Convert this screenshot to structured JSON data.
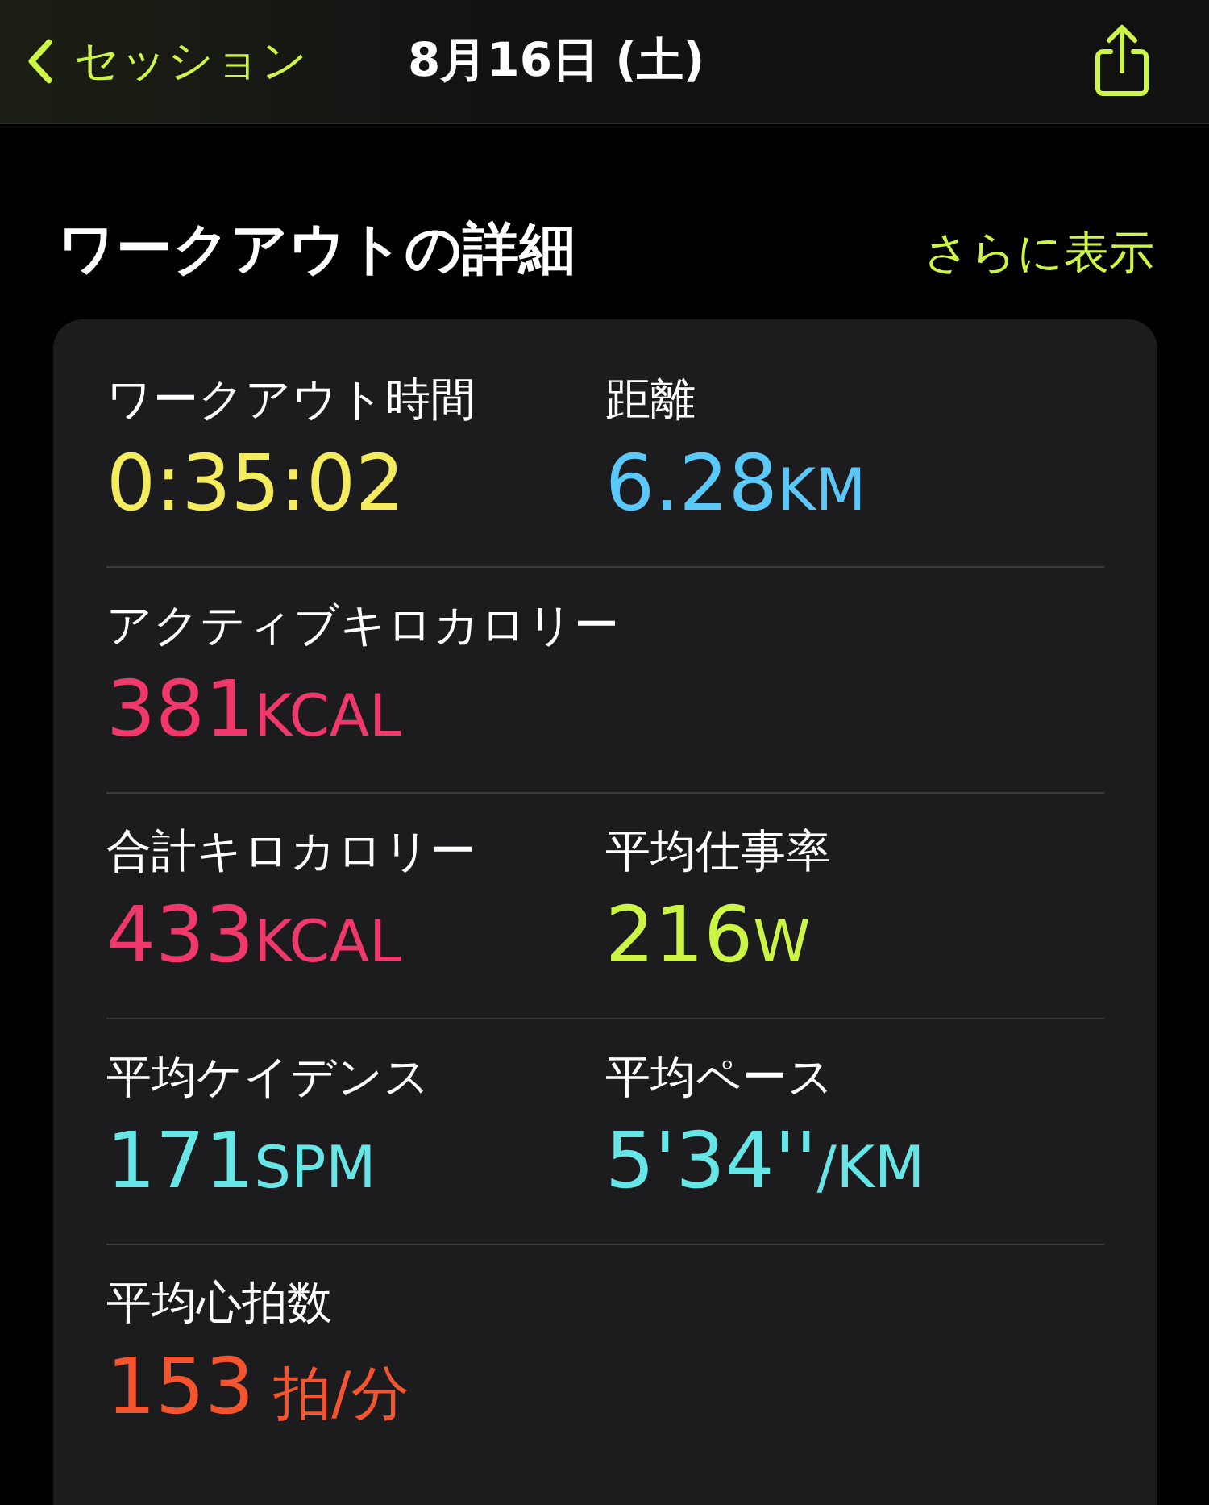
{
  "nav": {
    "back_label": "セッション",
    "title": "8月16日 (土)"
  },
  "section": {
    "title": "ワークアウトの詳細",
    "more_link": "さらに表示"
  },
  "rows": [
    {
      "metrics": [
        {
          "label": "ワークアウト時間",
          "value": "0:35:02",
          "color": "#f4ec5c"
        },
        {
          "label": "距離",
          "value": "6.28",
          "unit": "KM",
          "color": "#5ac8fa"
        }
      ]
    },
    {
      "metrics": [
        {
          "label": "アクティブキロカロリー",
          "value": "381",
          "unit": "KCAL",
          "color": "#f0386b"
        }
      ]
    },
    {
      "metrics": [
        {
          "label": "合計キロカロリー",
          "value": "433",
          "unit": "KCAL",
          "color": "#f0386b"
        },
        {
          "label": "平均仕事率",
          "value": "216",
          "unit": "W",
          "color": "#cdf545"
        }
      ]
    },
    {
      "metrics": [
        {
          "label": "平均ケイデンス",
          "value": "171",
          "unit": "SPM",
          "color": "#66e6e6"
        },
        {
          "label": "平均ペース",
          "value": "5'34''",
          "unit": "/KM",
          "color": "#66e6e6"
        }
      ]
    },
    {
      "metrics": [
        {
          "label": "平均心拍数",
          "value": "153",
          "unit": "拍/分",
          "color": "#f4552e"
        }
      ]
    }
  ]
}
